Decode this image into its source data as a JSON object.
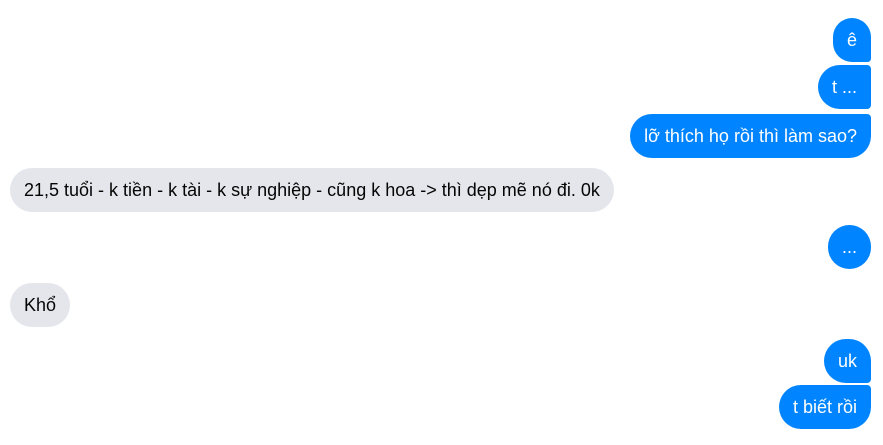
{
  "colors": {
    "outgoing_bubble": "#0084ff",
    "incoming_bubble": "#e4e6eb",
    "outgoing_text": "#ffffff",
    "incoming_text": "#050505"
  },
  "messages": [
    {
      "direction": "outgoing",
      "text": "ê"
    },
    {
      "direction": "outgoing",
      "text": "t ..."
    },
    {
      "direction": "outgoing",
      "text": "lỡ thích họ rồi thì làm sao?"
    },
    {
      "direction": "incoming",
      "text": "21,5 tuổi - k tiền - k tài - k sự nghiệp - cũng k hoa -> thì dẹp mẽ nó đi. 0k"
    },
    {
      "direction": "outgoing",
      "text": "..."
    },
    {
      "direction": "incoming",
      "text": "Khổ"
    },
    {
      "direction": "outgoing",
      "text": "uk"
    },
    {
      "direction": "outgoing",
      "text": "t biết rồi"
    }
  ]
}
